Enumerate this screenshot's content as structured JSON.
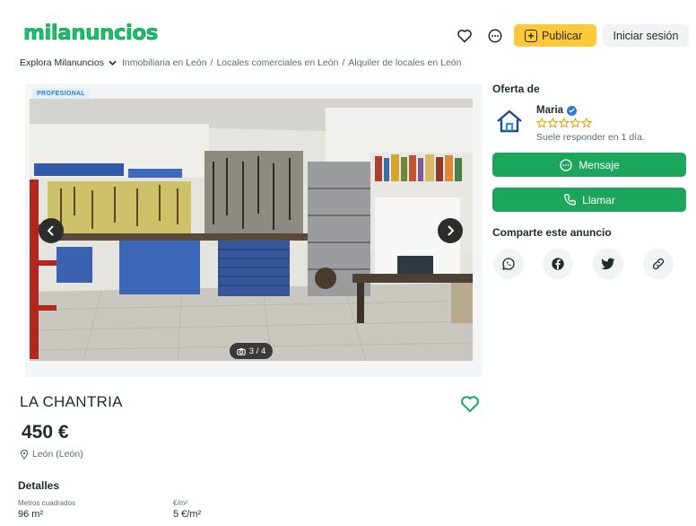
{
  "header": {
    "logo": "milanuncios",
    "publish_label": "Publicar",
    "login_label": "Iniciar sesión"
  },
  "breadcrumb": {
    "explore": "Explora Milanuncios",
    "items": [
      "Inmobiliaria en León",
      "Locales comerciales en León",
      "Alquiler de locales en León"
    ]
  },
  "gallery": {
    "badge": "PROFESIONAL",
    "counter": "3 / 4"
  },
  "listing": {
    "title": "LA CHANTRIA",
    "price": "450 €",
    "location": "León (León)"
  },
  "details": {
    "title": "Detalles",
    "items": [
      {
        "label": "Metros cuadrados",
        "value": "96 m²"
      },
      {
        "label": "€/m²",
        "value": "5 €/m²"
      }
    ]
  },
  "offer": {
    "title": "Oferta de",
    "seller_name": "Maria",
    "rating": 0,
    "rating_max": 5,
    "response_text": "Suele responder en 1 día.",
    "message_label": "Mensaje",
    "call_label": "Llamar"
  },
  "share": {
    "title": "Comparte este anuncio",
    "targets": [
      "whatsapp-icon",
      "facebook-icon",
      "twitter-icon",
      "link-icon"
    ]
  },
  "colors": {
    "brand_green": "#17c16a",
    "button_green": "#1ca65b",
    "publish_yellow": "#ffc73a",
    "verified_blue": "#2b7bd6"
  }
}
